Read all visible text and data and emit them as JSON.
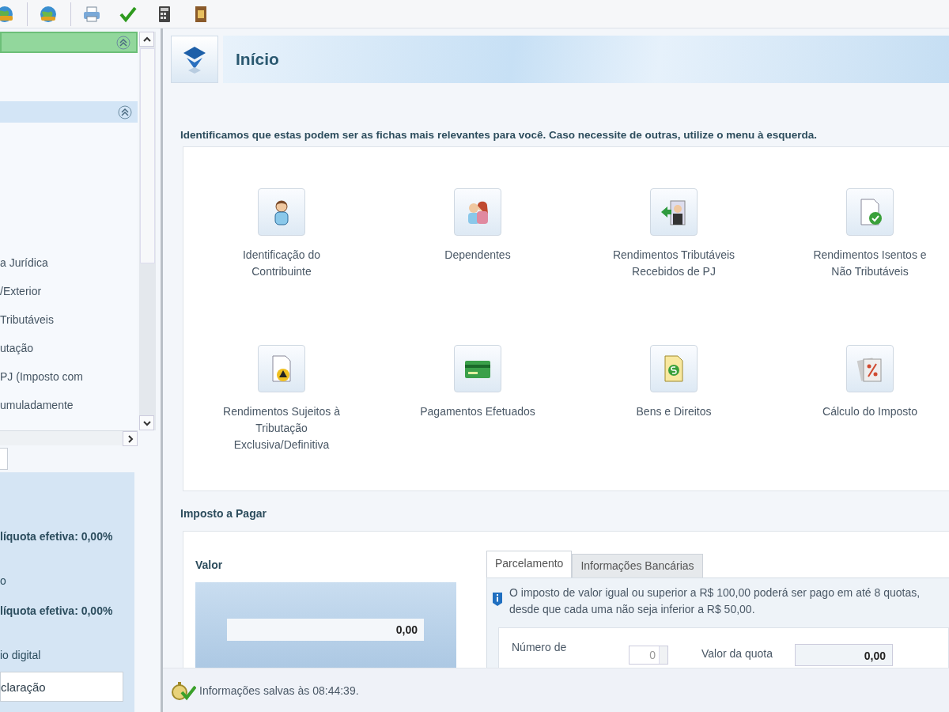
{
  "sidebar": {
    "sections": [
      {
        "selected": true,
        "expanded": true
      },
      {
        "selected": false,
        "expanded": true
      }
    ],
    "items": [
      "a Jurídica",
      "/Exterior",
      "Tributáveis",
      "utação",
      "PJ (Imposto com",
      "umuladamente"
    ],
    "summary": [
      {
        "text": "líquota efetiva: 0,00%",
        "bold": true
      },
      {
        "text": "o",
        "bold": false
      },
      {
        "text": "líquota efetiva: 0,00%",
        "bold": true
      },
      {
        "text": "io digital",
        "bold": false
      }
    ],
    "summary_button": "claração"
  },
  "page": {
    "title": "Início",
    "intro": "Identificamos que estas podem ser as fichas mais relevantes para você. Caso necessite de outras, utilize o menu à esquerda.",
    "fichas": [
      {
        "label": "Identificação do Contribuinte"
      },
      {
        "label": "Dependentes"
      },
      {
        "label": "Rendimentos Tributáveis Recebidos de PJ"
      },
      {
        "label": "Rendimentos Isentos e Não Tributáveis"
      },
      {
        "label": "Rendimentos Sujeitos à Tributação Exclusiva/Definitiva"
      },
      {
        "label": "Pagamentos Efetuados"
      },
      {
        "label": "Bens e Direitos"
      },
      {
        "label": "Cálculo do Imposto"
      }
    ]
  },
  "imposto": {
    "title": "Imposto a Pagar",
    "valor_label": "Valor",
    "valor": "0,00",
    "tabs": [
      {
        "label": "Parcelamento",
        "selected": true
      },
      {
        "label": "Informações Bancárias",
        "selected": false
      }
    ],
    "info": "O imposto de valor igual ou superior a R$ 100,00 poderá ser pago em até 8 quotas, desde que cada uma não seja inferior a R$ 50,00.",
    "numero_label": "Número de",
    "numero_value": "0",
    "quota_label": "Valor da quota",
    "quota_value": "0,00"
  },
  "status_bar": {
    "text": "Informações salvas às 08:44:39."
  }
}
